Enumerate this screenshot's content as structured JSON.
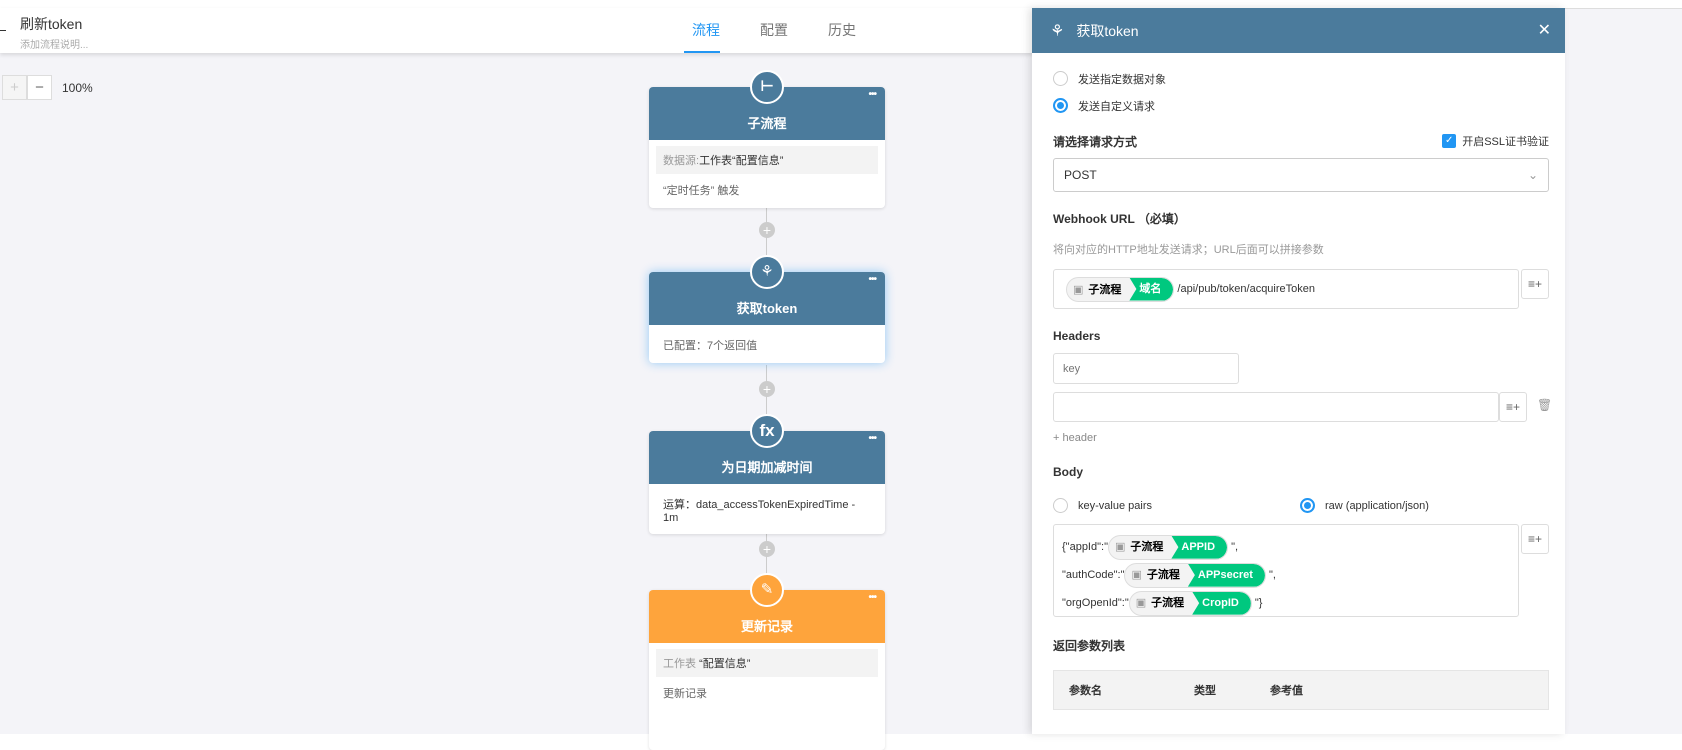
{
  "header": {
    "title": "刷新token",
    "description": "添加流程说明...",
    "tabs": [
      {
        "label": "流程"
      },
      {
        "label": "配置"
      },
      {
        "label": "历史"
      }
    ]
  },
  "zoom": {
    "plus": "+",
    "minus": "−",
    "value": "100%"
  },
  "nodes": [
    {
      "title": "子流程",
      "icon": "subprocess-icon",
      "source_label": "数据源:",
      "source_value": "工作表“配置信息”",
      "text": "“定时任务” 触发"
    },
    {
      "title": "获取token",
      "icon": "webhook-icon",
      "text": "已配置：7个返回值"
    },
    {
      "title": "为日期加减时间",
      "icon": "fx",
      "text": "运算：data_accessTokenExpiredTime - 1m"
    },
    {
      "title": "更新记录",
      "icon": "edit-icon",
      "source_label": "工作表",
      "source_value": "“配置信息”",
      "text": "更新记录"
    }
  ],
  "panel": {
    "title": "获取token",
    "close": "✕",
    "radio_options": [
      {
        "label": "发送指定数据对象",
        "checked": false
      },
      {
        "label": "发送自定义请求",
        "checked": true
      }
    ],
    "method_label": "请选择请求方式",
    "ssl_label": "开启SSL证书验证",
    "method_value": "POST",
    "webhook_label": "Webhook URL （必填）",
    "webhook_hint": "将向对应的HTTP地址发送请求；URL后面可以拼接参数",
    "url_tag": {
      "source": "子流程",
      "field": "域名"
    },
    "url_suffix": "/api/pub/token/acquireToken",
    "headers_label": "Headers",
    "key_placeholder": "key",
    "add_header": "+ header",
    "body_label": "Body",
    "body_options": [
      {
        "label": "key-value pairs",
        "checked": false
      },
      {
        "label": "raw (application/json)",
        "checked": true
      }
    ],
    "body_lines": [
      {
        "prefix": "{\"appId\":\"",
        "source": "子流程",
        "field": "APPID",
        "suffix": "\","
      },
      {
        "prefix": "\"authCode\":\"",
        "source": "子流程",
        "field": "APPsecret",
        "suffix": "\","
      },
      {
        "prefix": "\"orgOpenId\":\"",
        "source": "子流程",
        "field": "CropID",
        "suffix": "\"}"
      }
    ],
    "return_label": "返回参数列表",
    "table_headers": [
      "参数名",
      "类型",
      "参考值"
    ]
  }
}
